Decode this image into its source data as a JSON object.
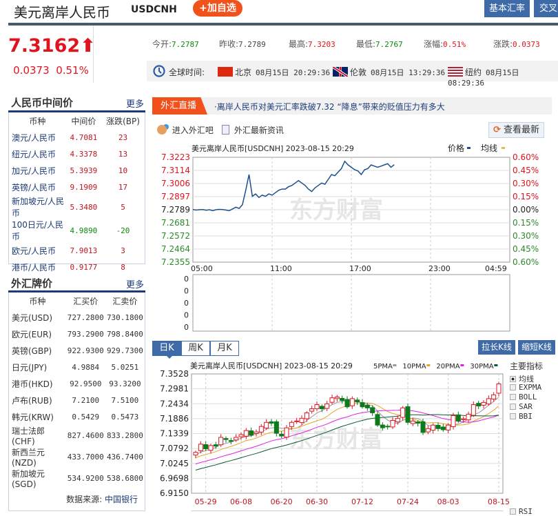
{
  "header": {
    "title": "美元离岸人民币",
    "code": "USDCNH",
    "add_label": "+加自选",
    "btn_basic": "基本汇率",
    "btn_cross": "交叉"
  },
  "quote": {
    "price": "7.3162",
    "arrow": "⬆",
    "change": "0.0373",
    "change_pct": "0.51%",
    "stats": [
      {
        "label": "今开:",
        "value": "7.2787",
        "color": "green"
      },
      {
        "label": "昨收:",
        "value": "7.2789",
        "color": "gray"
      },
      {
        "label": "最高:",
        "value": "7.3203",
        "color": "red"
      },
      {
        "label": "最低:",
        "value": "7.2767",
        "color": "green"
      },
      {
        "label": "涨幅:",
        "value": "0.51%",
        "color": "red"
      },
      {
        "label": "涨跌:",
        "value": "0.0373",
        "color": "red"
      }
    ],
    "time_label": "全球时间:",
    "zones": [
      {
        "city": "北京",
        "time": "08月15日 20:29:36",
        "flag": "cn"
      },
      {
        "city": "伦敦",
        "time": "08月15日 13:29:36",
        "flag": "uk"
      },
      {
        "city": "纽约",
        "time": "08月15日 08:29:36",
        "flag": "us"
      }
    ]
  },
  "mid": {
    "title": "人民币中间价",
    "more": "更多",
    "headers": [
      "币种",
      "中间价",
      "涨跌(BP)"
    ],
    "rows": [
      [
        "澳元/人民币",
        "4.7081",
        "23"
      ],
      [
        "纽元/人民币",
        "4.3378",
        "13"
      ],
      [
        "加元/人民币",
        "5.3939",
        "10"
      ],
      [
        "英镑/人民币",
        "9.1909",
        "17"
      ],
      [
        "新加坡元/人民币",
        "5.3480",
        "5"
      ],
      [
        "100日元/人民币",
        "4.9890",
        "-20"
      ],
      [
        "欧元/人民币",
        "7.9013",
        "3"
      ],
      [
        "港币/人民币",
        "0.9177",
        "8"
      ]
    ]
  },
  "board": {
    "title": "外汇牌价",
    "more": "更多",
    "headers": [
      "币种",
      "汇买价",
      "汇卖价"
    ],
    "rows": [
      [
        "美元(USD)",
        "727.2800",
        "730.1800"
      ],
      [
        "欧元(EUR)",
        "793.2900",
        "798.8400"
      ],
      [
        "英镑(GBP)",
        "922.9300",
        "929.7300"
      ],
      [
        "日元(JPY)",
        "4.9884",
        "5.0251"
      ],
      [
        "港币(HKD)",
        "92.9500",
        "93.3200"
      ],
      [
        "卢布(RUB)",
        "7.2100",
        "7.5100"
      ],
      [
        "韩元(KRW)",
        "0.5429",
        "0.5473"
      ],
      [
        "瑞士法郎(CHF)",
        "827.4600",
        "833.2800"
      ],
      [
        "新西兰元(NZD)",
        "433.7000",
        "436.7400"
      ],
      [
        "新加坡元(SGD)",
        "534.9200",
        "538.6800"
      ]
    ],
    "source_label": "数据来源:",
    "source": "中国银行"
  },
  "news": {
    "tag": "外汇直播",
    "headline": "·离岸人民币对美元汇率跌破7.32 “降息”带来的贬值压力有多大",
    "link_bar": "进入外汇吧",
    "link_news": "外汇最新资讯",
    "refresh": "查看最新"
  },
  "chart_data": [
    {
      "type": "line",
      "title": "美元离岸人民币[USDCNH] 2023-08-15 20:29",
      "legend": [
        "价格",
        "均线"
      ],
      "watermark": "东方财富",
      "ylim": [
        7.2355,
        7.3223
      ],
      "prev_close": 7.2789,
      "y_ticks": [
        "7.3223",
        "7.3114",
        "7.3006",
        "7.2897",
        "7.2789",
        "7.2681",
        "7.2572",
        "7.2464",
        "7.2355"
      ],
      "pct_ticks": [
        "0.60%",
        "0.45%",
        "0.30%",
        "0.15%",
        "0.00%",
        "0.15%",
        "0.30%",
        "0.45%",
        "0.60%"
      ],
      "x_ticks": [
        "05:00",
        "11:00",
        "17:00",
        "23:00",
        "04:59"
      ],
      "volume_ticks": [
        "0",
        "0",
        "0",
        "0",
        "0"
      ],
      "interval_minutes": 15,
      "total_points": 96,
      "values": [
        7.279,
        7.2786,
        7.2789,
        7.279,
        7.2785,
        7.2789,
        7.2781,
        7.2789,
        7.2792,
        7.279,
        7.2786,
        7.2781,
        7.2795,
        7.281,
        7.28,
        7.283,
        7.295,
        7.308,
        7.29,
        7.292,
        7.289,
        7.291,
        7.29,
        7.292,
        7.291,
        7.293,
        7.295,
        7.296,
        7.296,
        7.298,
        7.299,
        7.301,
        7.303,
        7.301,
        7.299,
        7.296,
        7.294,
        7.297,
        7.299,
        7.301,
        7.3,
        7.304,
        7.308,
        7.307,
        7.31,
        7.313,
        7.319,
        7.316,
        7.314,
        7.312,
        7.311,
        7.308,
        7.312,
        7.313,
        7.316,
        7.315,
        7.314,
        7.315,
        7.316,
        7.317,
        7.314,
        7.3162
      ],
      "colors": {
        "price": "#1c4f8a",
        "avg": "#e8b84a"
      }
    },
    {
      "type": "candlestick",
      "title": "美元离岸人民币[USDCNH] 2023-08-15 20:29",
      "tabs": [
        "日K",
        "周K",
        "月K"
      ],
      "active_tab": "日K",
      "buttons": [
        "拉长K线",
        "缩短K线"
      ],
      "legend": [
        {
          "name": "5PMA",
          "color": "#999999"
        },
        {
          "name": "10PMA",
          "color": "#e8a32a"
        },
        {
          "name": "20PMA",
          "color": "#e020e0"
        },
        {
          "name": "30PMA",
          "color": "#0a5a2a"
        }
      ],
      "ylim": [
        6.915,
        7.3528
      ],
      "y_ticks": [
        "7.3528",
        "7.2981",
        "7.2434",
        "7.1886",
        "7.1339",
        "7.0792",
        "7.0245",
        "6.9698",
        "6.9150"
      ],
      "x_ticks": [
        "05-29",
        "06-08",
        "06-20",
        "06-30",
        "07-12",
        "07-24",
        "08-03",
        "08-15"
      ],
      "indicators_title": "主要指标",
      "indicators": [
        "均线",
        "EXPMA",
        "BOLL",
        "SAR",
        "BBI"
      ],
      "active_indicator": "均线",
      "next_indicator": "RSI",
      "closes": [
        7.065,
        7.095,
        7.078,
        7.09,
        7.088,
        7.12,
        7.112,
        7.105,
        7.12,
        7.13,
        7.145,
        7.128,
        7.14,
        7.16,
        7.175,
        7.172,
        7.135,
        7.125,
        7.155,
        7.175,
        7.18,
        7.19,
        7.21,
        7.225,
        7.24,
        7.225,
        7.243,
        7.265,
        7.268,
        7.255,
        7.232,
        7.262,
        7.25,
        7.232,
        7.228,
        7.21,
        7.165,
        7.155,
        7.16,
        7.182,
        7.19,
        7.228,
        7.175,
        7.18,
        7.172,
        7.138,
        7.152,
        7.165,
        7.152,
        7.148,
        7.165,
        7.2,
        7.18,
        7.188,
        7.205,
        7.24,
        7.235,
        7.248,
        7.262,
        7.276,
        7.3162
      ],
      "MA_colors": [
        "#999999",
        "#e8a32a",
        "#e020e0",
        "#0a5a2a"
      ]
    }
  ]
}
